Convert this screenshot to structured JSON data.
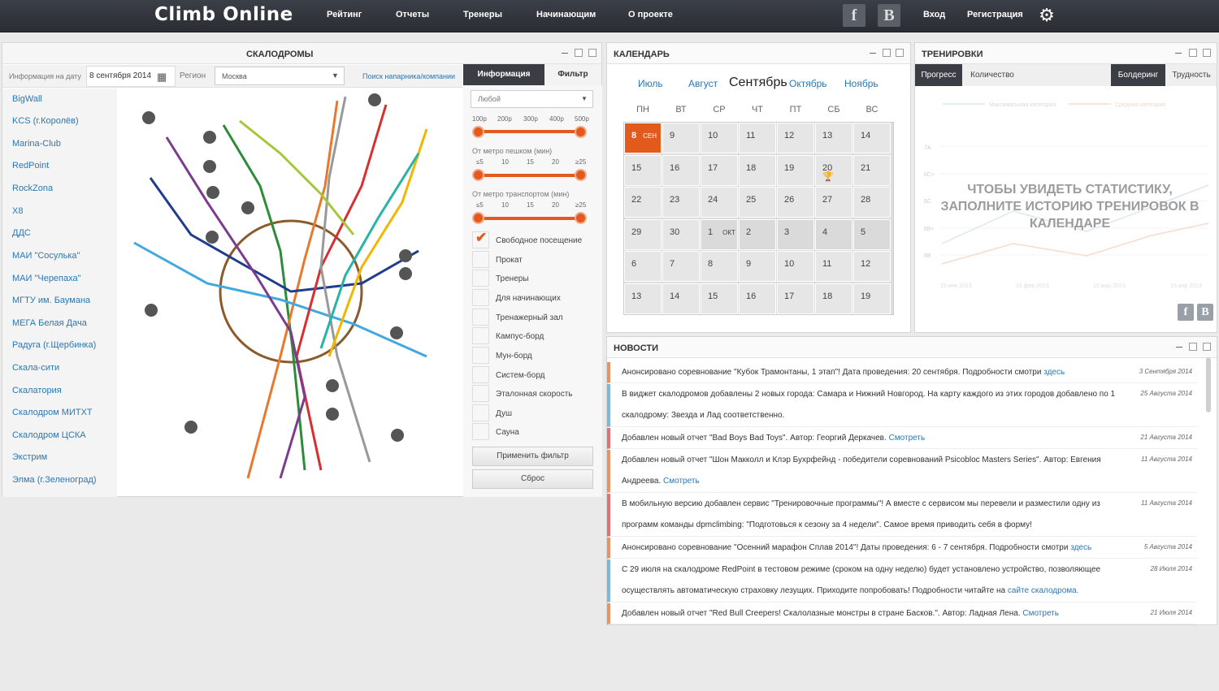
{
  "header": {
    "logo": "Climb Online",
    "nav": [
      "Рейтинг",
      "Отчеты",
      "Тренеры",
      "Начинающим",
      "О проекте"
    ],
    "social": [
      "f",
      "B"
    ],
    "login": "Вход",
    "register": "Регистрация"
  },
  "gyms_panel": {
    "title": "СКАЛОДРОМЫ",
    "date_label": "Информация на дату",
    "date_value": "8 сентября 2014",
    "region_label": "Регион",
    "region_value": "Москва",
    "partner_link": "Поиск напарника/компании",
    "gyms": [
      "BigWall",
      "KCS (г.Королёв)",
      "Marina-Club",
      "RedPoint",
      "RockZona",
      "X8",
      "ДДС",
      "МАИ \"Сосулька\"",
      "МАИ \"Черепаха\"",
      "МГТУ им. Баумана",
      "МЕГА Белая Дача",
      "Радуга (г.Щербинка)",
      "Скала-сити",
      "Скалатория",
      "Скалодром МИТХТ",
      "Скалодром ЦСКА",
      "Экстрим",
      "Элма (г.Зеленоград)"
    ],
    "tabs": [
      "Информация",
      "Фильтр"
    ],
    "filter": {
      "select_value": "Любой",
      "price_ticks": [
        "100р",
        "200р",
        "300р",
        "400р",
        "500р"
      ],
      "walk_title": "От метро пешком (мин)",
      "walk_ticks": [
        "≤5",
        "10",
        "15",
        "20",
        "≥25"
      ],
      "transport_title": "От метро транспортом (мин)",
      "transport_ticks": [
        "≤5",
        "10",
        "15",
        "20",
        "≥25"
      ],
      "options": [
        {
          "label": "Свободное посещение",
          "checked": true
        },
        {
          "label": "Прокат",
          "checked": false
        },
        {
          "label": "Тренеры",
          "checked": false
        },
        {
          "label": "Для начинающих",
          "checked": false
        },
        {
          "label": "Тренажерный зал",
          "checked": false
        },
        {
          "label": "Кампус-борд",
          "checked": false
        },
        {
          "label": "Мун-борд",
          "checked": false
        },
        {
          "label": "Систем-борд",
          "checked": false
        },
        {
          "label": "Эталонная скорость",
          "checked": false
        },
        {
          "label": "Душ",
          "checked": false
        },
        {
          "label": "Сауна",
          "checked": false
        }
      ],
      "apply": "Применить фильтр",
      "reset": "Сброс"
    }
  },
  "calendar": {
    "title": "КАЛЕНДАРЬ",
    "months": [
      "Июль",
      "Август",
      "Сентябрь",
      "Октябрь",
      "Ноябрь"
    ],
    "current_month": "Сентябрь",
    "weekdays": [
      "ПН",
      "ВТ",
      "СР",
      "ЧТ",
      "ПТ",
      "СБ",
      "ВС"
    ],
    "today_day": "8",
    "today_month_abbr": "СЕН",
    "oct_abbr": "ОКТ",
    "days": [
      [
        "8",
        "9",
        "10",
        "11",
        "12",
        "13",
        "14"
      ],
      [
        "15",
        "16",
        "17",
        "18",
        "19",
        "20",
        "21"
      ],
      [
        "22",
        "23",
        "24",
        "25",
        "26",
        "27",
        "28"
      ],
      [
        "29",
        "30",
        "1",
        "2",
        "3",
        "4",
        "5"
      ],
      [
        "6",
        "7",
        "8",
        "9",
        "10",
        "11",
        "12"
      ],
      [
        "13",
        "14",
        "15",
        "16",
        "17",
        "18",
        "19"
      ]
    ],
    "trophy_day": "20"
  },
  "training": {
    "title": "ТРЕНИРОВКИ",
    "tabs_left": [
      "Прогресс",
      "Количество"
    ],
    "tabs_right": [
      "Болдеринг",
      "Трудность"
    ],
    "legend": [
      "Максимальная категория",
      "Средняя категория"
    ],
    "y_ticks": [
      "7A",
      "6C+",
      "6C",
      "6B+",
      "6B"
    ],
    "x_ticks": [
      "15 янв 2013",
      "15 фев 2013",
      "15 мар 2013",
      "15 апр 2013"
    ],
    "overlay": "ЧТОБЫ УВИДЕТЬ СТАТИСТИКУ, ЗАПОЛНИТЕ ИСТОРИЮ ТРЕНИРОВОК В КАЛЕНДАРЕ",
    "social": [
      "f",
      "B"
    ]
  },
  "news": {
    "title": "НОВОСТИ",
    "items": [
      {
        "text": "Анонсировано соревнование \"Кубок Трамонтаны, 1 этап\"! Дата проведения: 20 сентября. Подробности смотри ",
        "link": "здесь",
        "date": "3 Сентября 2014",
        "color": "#e8926a"
      },
      {
        "text": "В виджет скалодромов добавлены 2 новых города: Самара и Нижний Новгород. На карту каждого из этих городов добавлено по 1 скалодрому: Звезда и Лад соответственно.",
        "link": "",
        "date": "25 Августа 2014",
        "color": "#7fb6da"
      },
      {
        "text": "Добавлен новый отчет \"Bad Boys Bad Toys\". Автор: Георгий Деркачев. ",
        "link": "Смотреть",
        "date": "21 Августа 2014",
        "color": "#e07272"
      },
      {
        "text": "Добавлен новый отчет \"Шон Макколл и Клэр Бухрфейнд - победители соревнований Psicobloc Masters Series\". Автор: Евгения Андреева. ",
        "link": "Смотреть",
        "date": "11 Августа 2014",
        "color": "#e8926a"
      },
      {
        "text": "В мобильную версию добавлен сервис \"Тренировочные программы\"! А вместе с сервисом мы перевели и разместили одну из программ команды dpmclimbing: \"Подготовься к сезону за 4 недели\". Самое время приводить себя в форму!",
        "link": "",
        "date": "11 Августа 2014",
        "color": "#e07272"
      },
      {
        "text": "Анонсировано соревнование \"Осенний марафон Сплав 2014\"! Даты проведения: 6 - 7 сентября. Подробности смотри ",
        "link": "здесь",
        "date": "5 Августа 2014",
        "color": "#e8926a"
      },
      {
        "text": "С 29 июля на скалодроме RedPoint в тестовом режиме (сроком на одну неделю) будет установлено устройство, позволяющее осуществлять автоматическую страховку лезущих. Приходите попробовать! Подробности читайте на ",
        "link": "сайте скалодрома.",
        "date": "28 Июля 2014",
        "color": "#7fb6da"
      },
      {
        "text": "Добавлен новый отчет \"Red Bull Creepers! Скалолазные монстры в стране Басков.\". Автор: Ладная Лена. ",
        "link": "Смотреть",
        "date": "21 Июля 2014",
        "color": "#e8926a"
      }
    ]
  },
  "colors": {
    "accent": "#e25b1c",
    "link": "#2a77b5",
    "topbar": "#2f3238",
    "dark_tab": "#3a3d44"
  }
}
